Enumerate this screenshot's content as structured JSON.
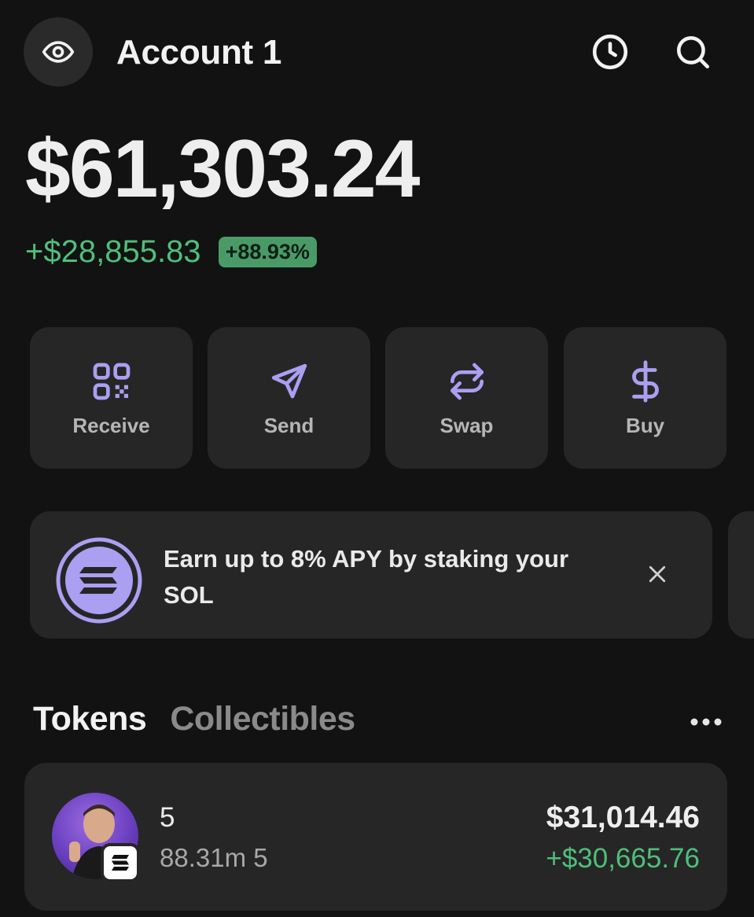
{
  "header": {
    "account_name": "Account 1",
    "icons": {
      "visibility": "eye-icon",
      "history": "clock-icon",
      "search": "search-icon"
    }
  },
  "balance": {
    "total": "$61,303.24",
    "change_amount": "+$28,855.83",
    "change_percent": "+88.93%"
  },
  "actions": [
    {
      "label": "Receive",
      "icon": "qr-code-icon"
    },
    {
      "label": "Send",
      "icon": "send-icon"
    },
    {
      "label": "Swap",
      "icon": "swap-icon"
    },
    {
      "label": "Buy",
      "icon": "dollar-icon"
    }
  ],
  "promo": {
    "text": "Earn up to 8% APY by staking your SOL",
    "icon": "solana-logo"
  },
  "tabs": {
    "tokens": "Tokens",
    "collectibles": "Collectibles",
    "selected": "Tokens"
  },
  "tokens": [
    {
      "name": "5",
      "amount": "88.31m 5",
      "value": "$31,014.46",
      "change": "+$30,665.76"
    }
  ],
  "colors": {
    "background": "#121212",
    "card": "#262626",
    "accent_purple": "#ab9ff2",
    "positive_green": "#4fbf7a"
  }
}
